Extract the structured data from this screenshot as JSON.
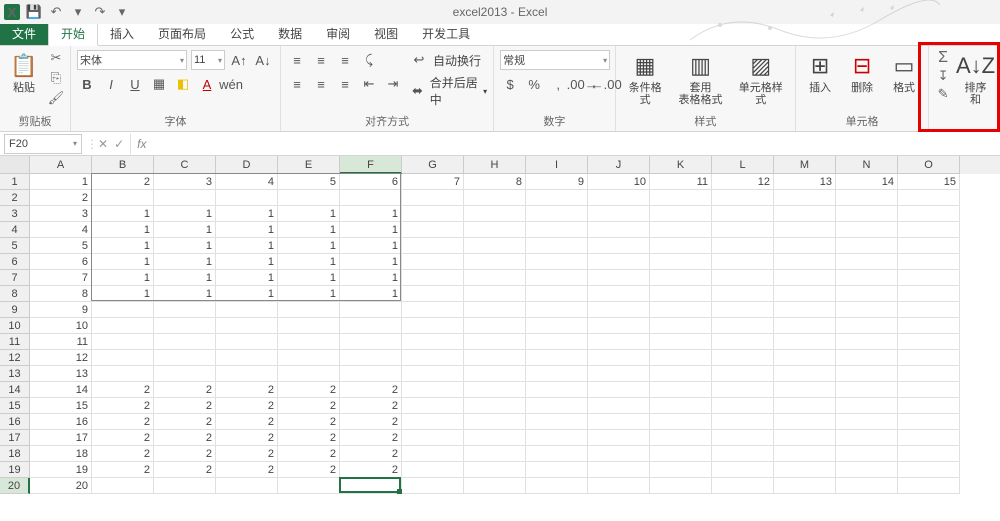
{
  "title": "excel2013 - Excel",
  "qat": {
    "save": "💾",
    "undo": "↶",
    "redo": "↷"
  },
  "tabs": [
    "文件",
    "开始",
    "插入",
    "页面布局",
    "公式",
    "数据",
    "审阅",
    "视图",
    "开发工具"
  ],
  "activeTab": "开始",
  "ribbon": {
    "clipboard": {
      "label": "剪贴板",
      "paste": "粘贴"
    },
    "font": {
      "label": "字体",
      "name": "宋体",
      "size": "11",
      "bold": "B",
      "italic": "I",
      "underline": "U"
    },
    "align": {
      "label": "对齐方式",
      "wrap": "自动换行",
      "merge": "合并后居中"
    },
    "number": {
      "label": "数字",
      "format": "常规"
    },
    "styles": {
      "label": "样式",
      "cond": "条件格式",
      "table": "套用\n表格格式",
      "cell": "单元格样式"
    },
    "cells": {
      "label": "单元格",
      "insert": "插入",
      "delete": "删除",
      "format": "格式"
    },
    "editing": {
      "sort": "排序和"
    }
  },
  "nameBox": "F20",
  "columns": [
    "A",
    "B",
    "C",
    "D",
    "E",
    "F",
    "G",
    "H",
    "I",
    "J",
    "K",
    "L",
    "M",
    "N",
    "O"
  ],
  "activeCol": "F",
  "activeRow": 20,
  "rowCount": 20,
  "chart_data": {
    "type": "table",
    "note": "Spreadsheet cell values; rows 1-indexed, columns by letter",
    "rows": [
      {
        "r": 1,
        "A": 1,
        "B": 2,
        "C": 3,
        "D": 4,
        "E": 5,
        "F": 6,
        "G": 7,
        "H": 8,
        "I": 9,
        "J": 10,
        "K": 11,
        "L": 12,
        "M": 13,
        "N": 14,
        "O": 15
      },
      {
        "r": 2,
        "A": 2
      },
      {
        "r": 3,
        "A": 3,
        "B": 1,
        "C": 1,
        "D": 1,
        "E": 1,
        "F": 1
      },
      {
        "r": 4,
        "A": 4,
        "B": 1,
        "C": 1,
        "D": 1,
        "E": 1,
        "F": 1
      },
      {
        "r": 5,
        "A": 5,
        "B": 1,
        "C": 1,
        "D": 1,
        "E": 1,
        "F": 1
      },
      {
        "r": 6,
        "A": 6,
        "B": 1,
        "C": 1,
        "D": 1,
        "E": 1,
        "F": 1
      },
      {
        "r": 7,
        "A": 7,
        "B": 1,
        "C": 1,
        "D": 1,
        "E": 1,
        "F": 1
      },
      {
        "r": 8,
        "A": 8,
        "B": 1,
        "C": 1,
        "D": 1,
        "E": 1,
        "F": 1
      },
      {
        "r": 9,
        "A": 9
      },
      {
        "r": 10,
        "A": 10
      },
      {
        "r": 11,
        "A": 11
      },
      {
        "r": 12,
        "A": 12
      },
      {
        "r": 13,
        "A": 13
      },
      {
        "r": 14,
        "A": 14,
        "B": 2,
        "C": 2,
        "D": 2,
        "E": 2,
        "F": 2
      },
      {
        "r": 15,
        "A": 15,
        "B": 2,
        "C": 2,
        "D": 2,
        "E": 2,
        "F": 2
      },
      {
        "r": 16,
        "A": 16,
        "B": 2,
        "C": 2,
        "D": 2,
        "E": 2,
        "F": 2
      },
      {
        "r": 17,
        "A": 17,
        "B": 2,
        "C": 2,
        "D": 2,
        "E": 2,
        "F": 2
      },
      {
        "r": 18,
        "A": 18,
        "B": 2,
        "C": 2,
        "D": 2,
        "E": 2,
        "F": 2
      },
      {
        "r": 19,
        "A": 19,
        "B": 2,
        "C": 2,
        "D": 2,
        "E": 2,
        "F": 2
      },
      {
        "r": 20,
        "A": 20
      }
    ]
  }
}
